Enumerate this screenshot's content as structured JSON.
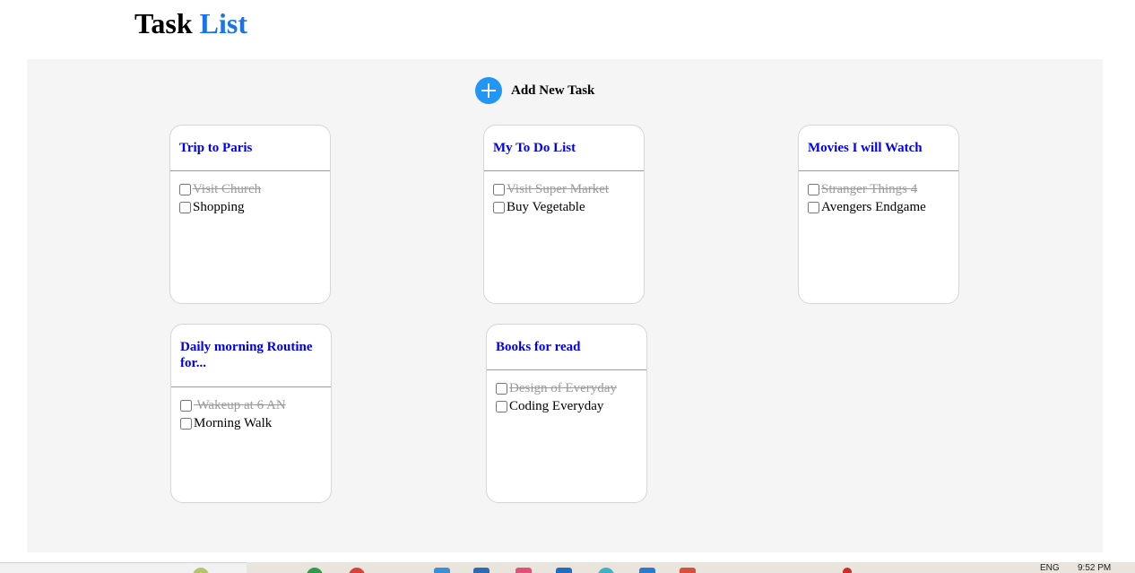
{
  "header": {
    "title_part1": "Task",
    "title_part2": "List"
  },
  "toolbar": {
    "add_label": "Add New Task"
  },
  "colors": {
    "accent": "#1a73e8",
    "add_button": "#2196f3",
    "card_title": "#0000ee",
    "board_bg": "#f6f5f6",
    "done_text": "#9a9a9a"
  },
  "cards": [
    {
      "title": "Trip to Paris",
      "items": [
        {
          "label": "Visit Church",
          "done": true
        },
        {
          "label": "Shopping",
          "done": false
        }
      ]
    },
    {
      "title": "My To Do List",
      "items": [
        {
          "label": "Visit Super Market",
          "done": true
        },
        {
          "label": "Buy Vegetable",
          "done": false
        }
      ]
    },
    {
      "title": "Movies I will Watch",
      "items": [
        {
          "label": "Stranger Things 4",
          "done": true
        },
        {
          "label": "Avengers Endgame",
          "done": false
        }
      ]
    },
    {
      "title": "Daily morning Routine for...",
      "items": [
        {
          "label": " Wakeup at 6 AN",
          "done": true
        },
        {
          "label": "Morning Walk",
          "done": false
        }
      ]
    },
    {
      "title": "Books for read",
      "items": [
        {
          "label": "Design of Everyday",
          "done": true
        },
        {
          "label": "Coding Everyday",
          "done": false
        }
      ]
    }
  ],
  "taskbar": {
    "lang": "ENG",
    "time": "9:52 PM"
  }
}
